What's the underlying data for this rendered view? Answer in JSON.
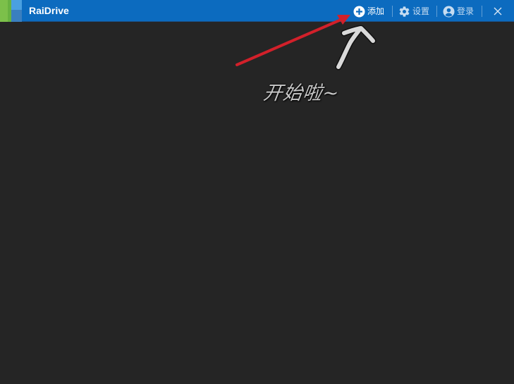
{
  "window": {
    "title": "RaiDrive",
    "brand_colors": {
      "titlebar": "#0c6bbf",
      "body": "#252525",
      "logo_green": "#7cc04a",
      "logo_blue": "#3f8fd4"
    }
  },
  "toolbar": {
    "add_label": "添加",
    "add_icon": "plus-circle-icon",
    "settings_label": "设置",
    "settings_icon": "gear-icon",
    "login_label": "登录",
    "login_icon": "user-circle-icon",
    "close_icon": "close-icon"
  },
  "annotation": {
    "caption": "开始啦~",
    "arrow_color": "#d2202a",
    "hand_arrow_color": "#d9d9d9"
  }
}
